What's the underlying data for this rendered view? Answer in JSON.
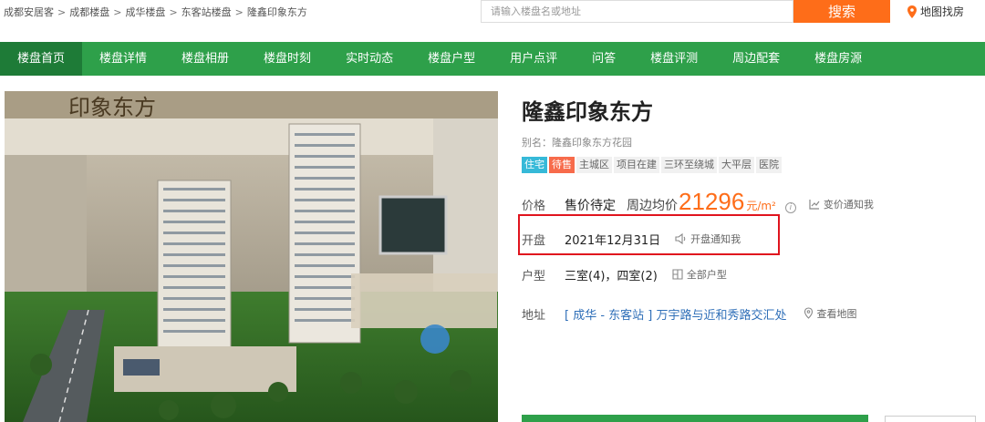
{
  "breadcrumb": [
    "成都安居客",
    "成都楼盘",
    "成华楼盘",
    "东客站楼盘",
    "隆鑫印象东方"
  ],
  "breadcrumb_sep": ">",
  "search": {
    "placeholder": "请输入楼盘名或地址",
    "button_label": "搜索"
  },
  "map_find_label": "地图找房",
  "nav": {
    "items": [
      "楼盘首页",
      "楼盘详情",
      "楼盘相册",
      "楼盘时刻",
      "实时动态",
      "楼盘户型",
      "用户点评",
      "问答",
      "楼盘评测",
      "周边配套",
      "楼盘房源"
    ],
    "active_index": 0
  },
  "property": {
    "name": "隆鑫印象东方",
    "alias": "别名：隆鑫印象东方花园",
    "tags": [
      {
        "text": "住宅",
        "kind": "type"
      },
      {
        "text": "待售",
        "kind": "status"
      },
      {
        "text": "主城区",
        "kind": "plain"
      },
      {
        "text": "项目在建",
        "kind": "plain"
      },
      {
        "text": "三环至绕城",
        "kind": "plain"
      },
      {
        "text": "大平层",
        "kind": "plain"
      },
      {
        "text": "医院",
        "kind": "plain"
      }
    ],
    "price": {
      "label": "价格",
      "pending": "售价待定",
      "avg_label": "周边均价",
      "avg_value": "21296",
      "avg_unit": "元/m²",
      "info_glyph": "i",
      "notify_label": "变价通知我"
    },
    "opening": {
      "label": "开盘",
      "date": "2021年12月31日",
      "notify_label": "开盘通知我"
    },
    "layout": {
      "label": "户型",
      "value": "三室(4)，四室(2)",
      "all_label": "全部户型"
    },
    "address": {
      "label": "地址",
      "value": "[ 成华 - 东客站 ] 万宇路与近和秀路交汇处",
      "map_label": "查看地图"
    },
    "photo_sign": "印象东方"
  },
  "colors": {
    "brand_green": "#2ea04a",
    "orange": "#fe6d19",
    "highlight_red": "#e0141e",
    "link_blue": "#2f6fb8"
  }
}
